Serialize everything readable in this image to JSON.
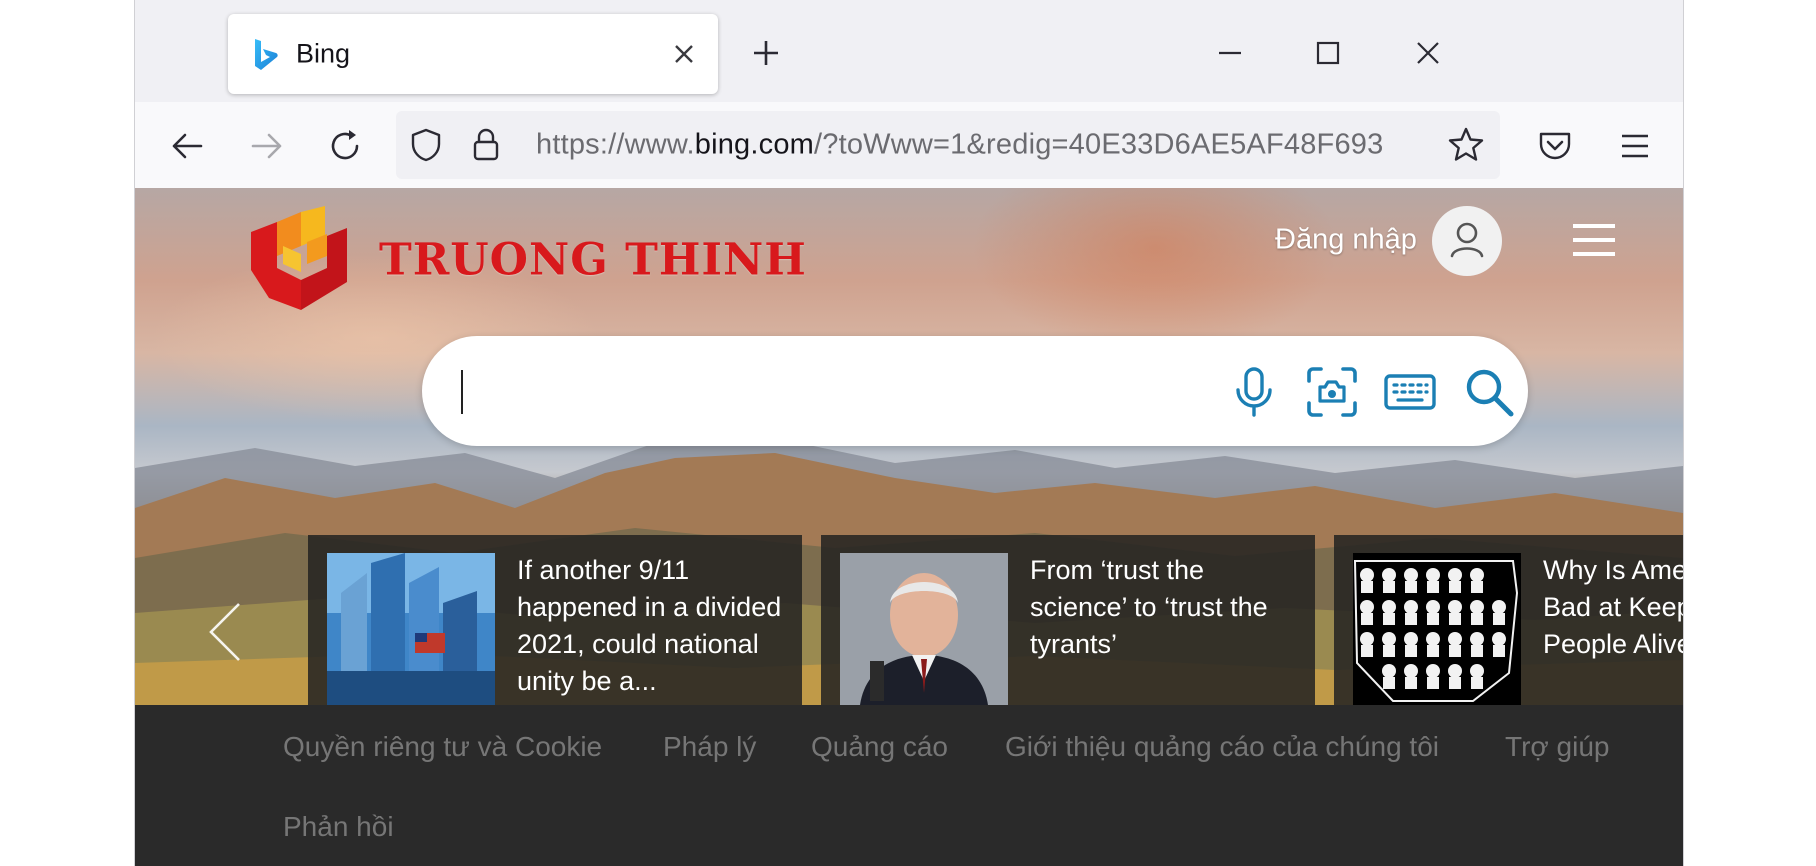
{
  "browser": {
    "tab": {
      "title": "Bing",
      "favicon": "bing-icon",
      "close": "close-icon"
    },
    "new_tab": "plus-icon",
    "window_controls": [
      "minimize-icon",
      "maximize-icon",
      "close-icon"
    ],
    "nav": [
      "back-arrow-icon",
      "forward-arrow-icon",
      "reload-icon"
    ],
    "url": {
      "prefix": "https://www.",
      "host": "bing.com",
      "suffix": "/?toWww=1&redig=40E33D6AE5AF48F693"
    },
    "toolbar_icons": [
      "shield-icon",
      "lock-icon",
      "star-icon",
      "pocket-icon",
      "menu-icon"
    ]
  },
  "page": {
    "brand": {
      "name": "TRUONG THINH",
      "logo": "truong-thinh-logo"
    },
    "header": {
      "signin_label": "Đăng nhập"
    },
    "search": {
      "value": "",
      "tools": [
        "microphone-icon",
        "visual-search-icon",
        "keyboard-icon",
        "search-icon"
      ]
    },
    "news": [
      {
        "title": "If another 9/11 happened in a divided 2021, could national unity be a..."
      },
      {
        "title": "From ‘trust the science’ to ‘trust the tyrants’"
      },
      {
        "title": "Why Is America So Bad at Keeping People Alive"
      }
    ],
    "footer": {
      "links": [
        "Quyền riêng tư và Cookie",
        "Pháp lý",
        "Quảng cáo",
        "Giới thiệu quảng cáo của chúng tôi",
        "Trợ giúp",
        "Phản hồi"
      ]
    }
  },
  "colors": {
    "bing_accent": "#1b7fb4",
    "brand_red": "#d8191c",
    "footer_bg": "#2a2a2a",
    "footer_text": "#767676"
  }
}
